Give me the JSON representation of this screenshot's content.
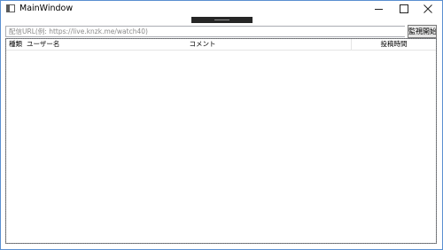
{
  "window": {
    "title": "MainWindow"
  },
  "toolbar": {
    "url_placeholder": "配信URL(例: https://live.knzk.me/watch40)",
    "url_value": "",
    "watch_button_label": "監視開始"
  },
  "listview": {
    "columns": [
      {
        "label": "種類"
      },
      {
        "label": "ユーザー名"
      },
      {
        "label": "コメント"
      },
      {
        "label": "投稿時間"
      }
    ],
    "rows": []
  }
}
